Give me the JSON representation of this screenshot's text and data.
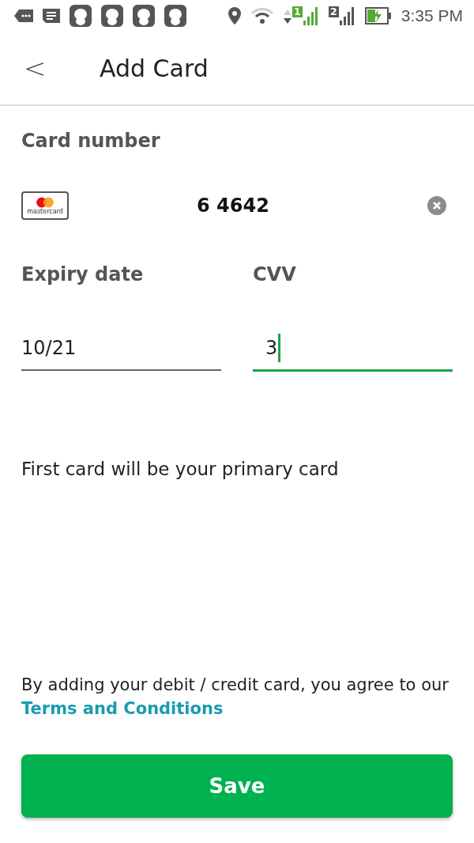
{
  "status_bar": {
    "sim_1": "1",
    "sim_2": "2",
    "time": "3:35 PM"
  },
  "header": {
    "back": "<",
    "title": "Add Card"
  },
  "card_number": {
    "label": "Card number",
    "value": "6 4642",
    "brand_caption": "mastercard"
  },
  "expiry": {
    "label": "Expiry date",
    "value": "10/21",
    "focused": false
  },
  "cvv": {
    "label": "CVV",
    "value": "3",
    "focused": true
  },
  "note": "First card will be your primary card",
  "terms": {
    "text": "By adding your debit / credit card, you agree to our",
    "link": "Terms and Conditions"
  },
  "save_button": "Save"
}
